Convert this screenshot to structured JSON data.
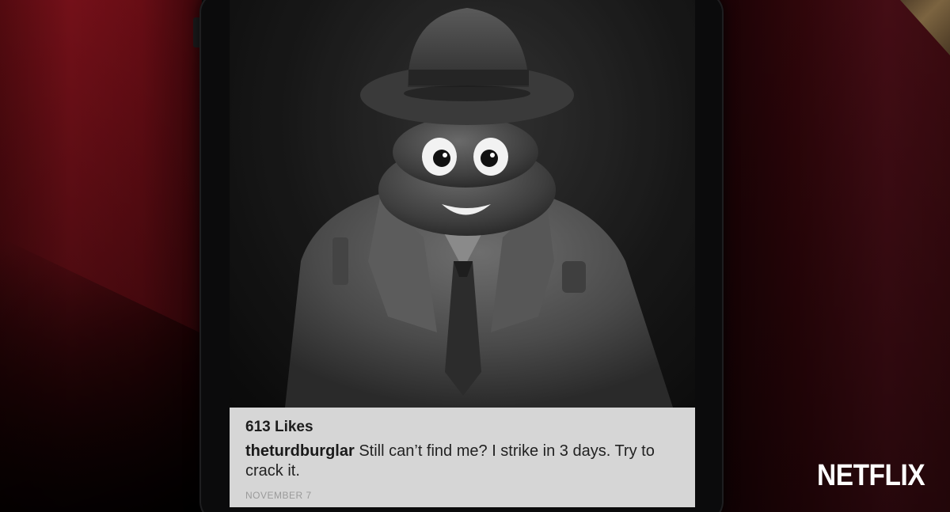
{
  "post": {
    "likes": "613 Likes",
    "username": "theturdburglar",
    "caption": "Still can’t find me? I strike in 3 days. Try to crack it.",
    "date": "NOVEMBER 7"
  },
  "photo": {
    "subject": "poop-emoji-detective-icon"
  },
  "watermark": {
    "text": "NETFLIX"
  },
  "colors": {
    "caption_bg": "#d6d6d6",
    "drape_red": "#7a111a",
    "watermark": "#ffffff"
  }
}
